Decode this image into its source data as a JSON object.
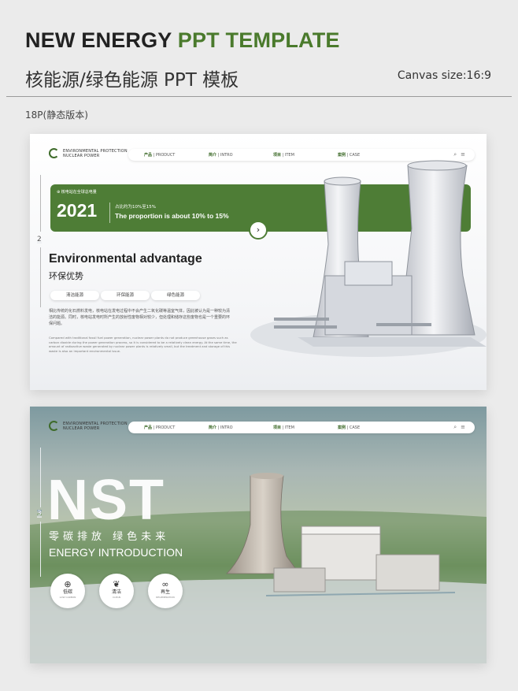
{
  "header": {
    "title_part1": "NEW ENERGY",
    "title_part2": "PPT TEMPLATE",
    "subtitle": "核能源/绿色能源 PPT 模板",
    "canvas_size": "Canvas size:16:9",
    "pages": "18P(静态版本)"
  },
  "colors": {
    "brand_green": "#4e7d36",
    "title_green": "#4a7a2c"
  },
  "brand": {
    "line1": "ENVIRONMENTAL PROTECTION",
    "line2": "NUCLEAR POWER"
  },
  "nav": [
    {
      "cn": "产品",
      "en": "| PRODUCT"
    },
    {
      "cn": "简介",
      "en": "| INTRO"
    },
    {
      "cn": "项目",
      "en": "| ITEM"
    },
    {
      "cn": "案例",
      "en": "| CASE"
    }
  ],
  "slide1": {
    "page_number": "2",
    "banner_small": "核电站在全球总电量",
    "year": "2021",
    "banner_cn": "占比约为10%至15%",
    "banner_en": "The proportion is about 10% to 15%",
    "heading_en": "Environmental advantage",
    "heading_cn": "环保优势",
    "tags": [
      "清洁能源",
      "环保能源",
      "绿色能源"
    ],
    "para_cn": "相比传统的化石燃料发电，核电站在发电过程中不会产生二氧化碳等温室气体，因此被认为是一种较为清洁的能源。同时，核电站发电时所产生的放射性废物相对较少，但处理和储存这些废物也是一个重要的环保问题。",
    "para_en": "Compared with traditional fossil fuel power generation, nuclear power plants do not produce greenhouse gases such as carbon dioxide during the power generation process, so it is considered to be a relatively clean energy. At the same time, the amount of radioactive waste generated by nuclear power plants is relatively small, but the treatment and storage of this waste is also an important environmental issue."
  },
  "slide2": {
    "page_number": "3",
    "big_text": "NST",
    "slogan": "零碳排放  绿色未来",
    "energy_intro": "ENERGY INTRODUCTION",
    "features": [
      {
        "icon": "globe-icon",
        "cn": "低碳",
        "en": "LOW CARBON"
      },
      {
        "icon": "leaf-icon",
        "cn": "清洁",
        "en": "CLEAN"
      },
      {
        "icon": "infinity-icon",
        "cn": "再生",
        "en": "REGENERATION"
      }
    ]
  }
}
